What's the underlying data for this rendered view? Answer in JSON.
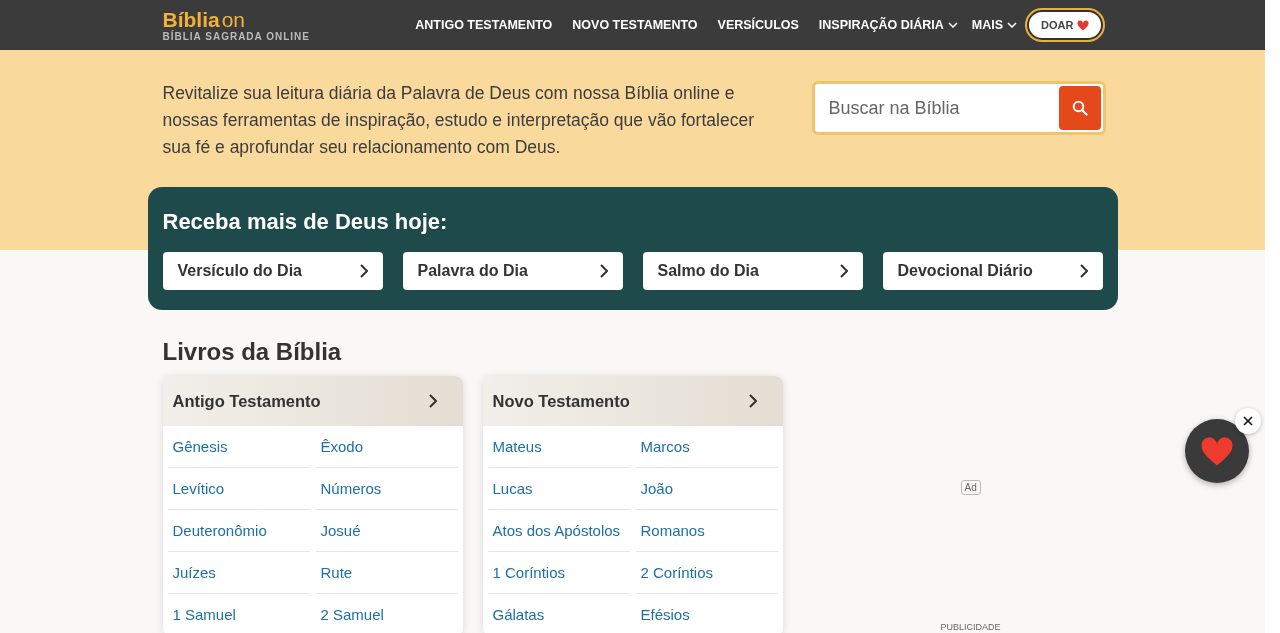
{
  "header": {
    "logo": {
      "word": "Bíblia",
      "suffix": "on",
      "tagline": "BÍBLIA SAGRADA ONLINE"
    },
    "nav": [
      {
        "label": "ANTIGO TESTAMENTO",
        "dropdown": false
      },
      {
        "label": "NOVO TESTAMENTO",
        "dropdown": false
      },
      {
        "label": "VERSÍCULOS",
        "dropdown": false
      },
      {
        "label": "INSPIRAÇÃO DIÁRIA",
        "dropdown": true
      },
      {
        "label": "MAIS",
        "dropdown": true
      }
    ],
    "donate": "DOAR"
  },
  "hero": {
    "intro": "Revitalize sua leitura diária da Palavra de Deus com nossa Bíblia online e nossas ferramentas de inspiração, estudo e interpretação que vão fortalecer sua fé e aprofundar seu relacionamento com Deus.",
    "search": {
      "placeholder": "Buscar na Bíblia"
    }
  },
  "daily": {
    "title": "Receba mais de Deus hoje:",
    "links": [
      "Versículo do Dia",
      "Palavra do Dia",
      "Salmo do Dia",
      "Devocional Diário"
    ]
  },
  "books": {
    "title": "Livros da Bíblia",
    "testaments": [
      {
        "name": "Antigo Testamento",
        "books": [
          "Gênesis",
          "Êxodo",
          "Levítico",
          "Números",
          "Deuteronômio",
          "Josué",
          "Juízes",
          "Rute",
          "1 Samuel",
          "2 Samuel"
        ]
      },
      {
        "name": "Novo Testamento",
        "books": [
          "Mateus",
          "Marcos",
          "Lucas",
          "João",
          "Atos dos Apóstolos",
          "Romanos",
          "1 Coríntios",
          "2 Coríntios",
          "Gálatas",
          "Efésios"
        ]
      }
    ]
  },
  "ad": {
    "badge": "Ad",
    "label": "PUBLICIDADE"
  }
}
